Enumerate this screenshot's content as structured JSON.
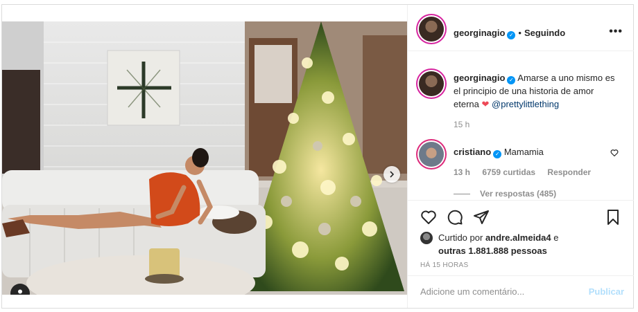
{
  "post": {
    "author": "georginagio",
    "follow_status": "Seguindo",
    "separator": "•",
    "more": "•••",
    "caption_author": "georginagio",
    "caption_text": "Amarse a uno mismo es el principio de una historia de amor eterna",
    "caption_emoji": "❤",
    "caption_mention": "@prettylittlething",
    "caption_time": "15 h"
  },
  "comment": {
    "author": "cristiano",
    "text": "Mamamia",
    "time": "13 h",
    "likes": "6759 curtidas",
    "reply": "Responder",
    "view_replies": "Ver respostas (485)"
  },
  "likes": {
    "prefix": "Curtido por",
    "user": "andre.almeida4",
    "suffix": "e",
    "others": "outras 1.881.888 pessoas"
  },
  "timestamp": "HÁ 15 HORAS",
  "comment_input": {
    "placeholder": "Adicione um comentário..."
  },
  "publish_label": "Publicar",
  "carousel": {
    "count": 2,
    "active": 1
  },
  "colors": {
    "accent": "#0095f6",
    "heart": "#ed4956",
    "mention": "#00376b"
  }
}
